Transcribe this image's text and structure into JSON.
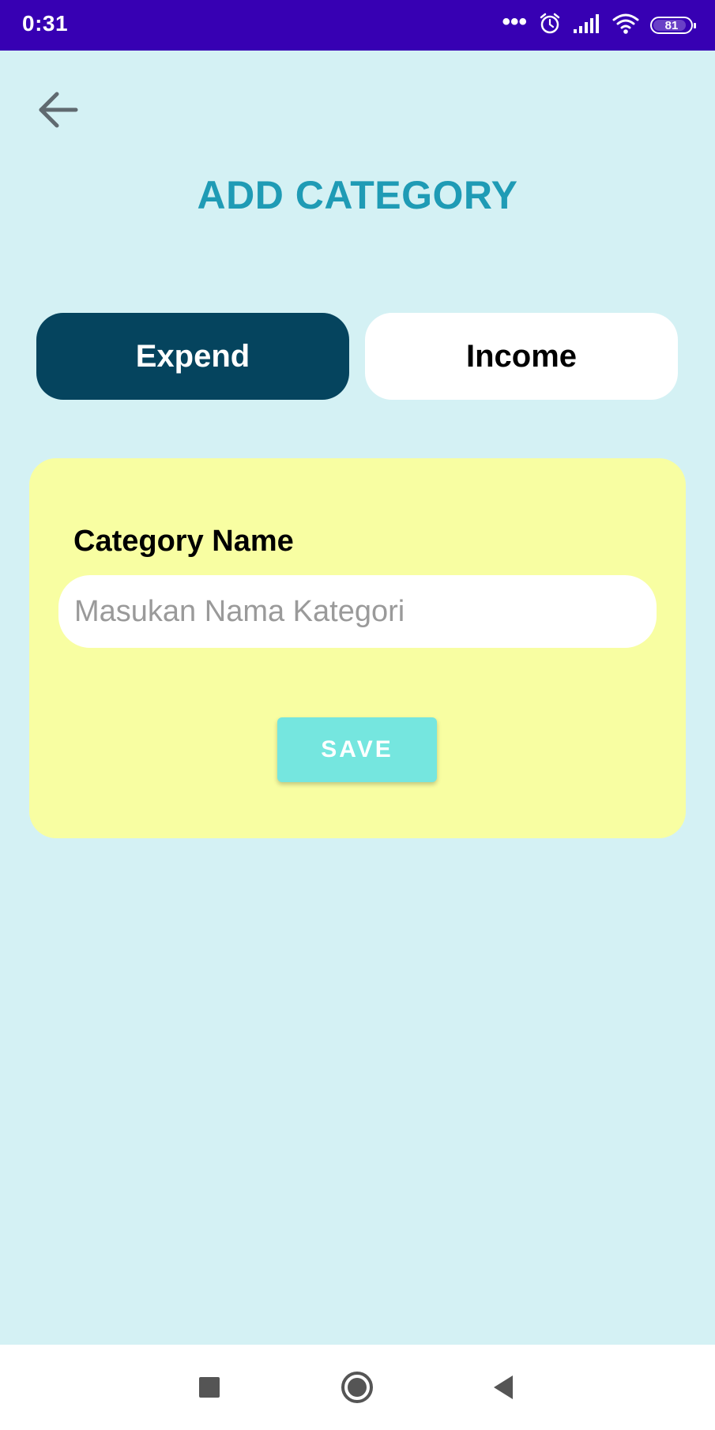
{
  "status_bar": {
    "time": "0:31",
    "battery": "81",
    "background_color": "#3700b3"
  },
  "header": {
    "back_icon": "arrow-left-icon",
    "title": "ADD CATEGORY",
    "title_color": "#1f9bb5"
  },
  "tabs": [
    {
      "label": "Expend",
      "selected": true,
      "background_color": "#05445e"
    },
    {
      "label": "Income",
      "selected": false,
      "background_color": "#ffffff"
    }
  ],
  "form": {
    "card_color": "#f8fea2",
    "field_label": "Category Name",
    "input_value": "",
    "input_placeholder": "Masukan Nama Kategori",
    "save_label": "SAVE",
    "save_color": "#75e6df"
  },
  "nav_bar": {
    "icons": [
      "recents-square-icon",
      "home-circle-icon",
      "back-triangle-icon"
    ]
  },
  "colors": {
    "page_background": "#d4f1f4"
  }
}
